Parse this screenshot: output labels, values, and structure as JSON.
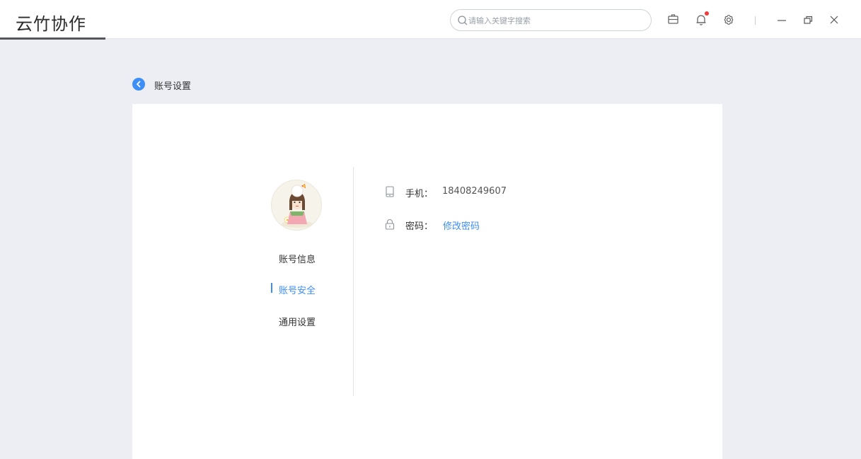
{
  "app": {
    "title": "云竹协作"
  },
  "search": {
    "placeholder": "请输入关键字搜索",
    "value": ""
  },
  "toolbar": {
    "icons": [
      "briefcase-icon",
      "bell-icon",
      "gear-icon"
    ],
    "window_controls": [
      "minimize-icon",
      "restore-icon",
      "close-icon"
    ],
    "notification_dot_color": "#ef3b3b"
  },
  "page": {
    "title": "账号设置"
  },
  "nav": {
    "items": [
      {
        "label": "账号信息",
        "active": false
      },
      {
        "label": "账号安全",
        "active": true
      },
      {
        "label": "通用设置",
        "active": false
      }
    ]
  },
  "security": {
    "phone": {
      "label": "手机：",
      "value": "18408249607",
      "icon": "phone-icon"
    },
    "password": {
      "label": "密码：",
      "link": "修改密码",
      "icon": "lock-icon"
    }
  },
  "colors": {
    "accent": "#3e8ef7",
    "background": "#eceef4",
    "card": "#ffffff"
  }
}
